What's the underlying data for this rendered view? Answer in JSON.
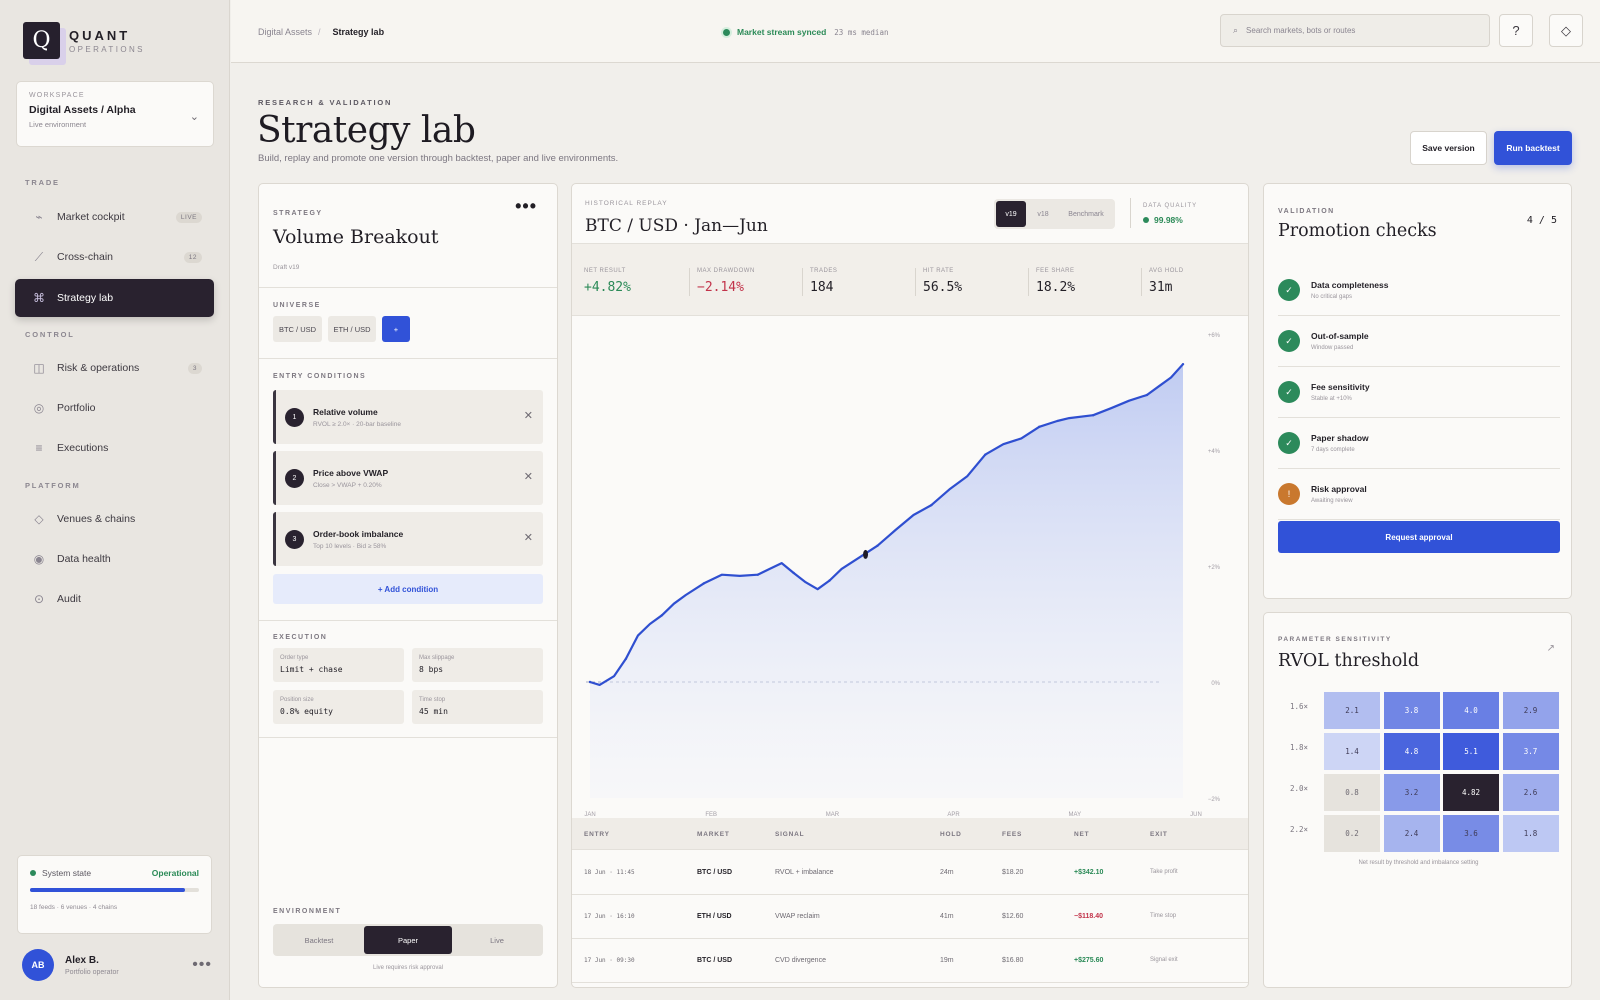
{
  "brand": {
    "logo_letter": "Q",
    "name": "QUANT",
    "tagline": "OPERATIONS"
  },
  "workspace": {
    "label": "WORKSPACE",
    "name": "Digital Assets / Alpha",
    "env": "Live environment"
  },
  "sidebar": {
    "trade_label": "TRADE",
    "control_label": "CONTROL",
    "platform_label": "PLATFORM",
    "items": [
      {
        "label": "Market cockpit",
        "badge": "LIVE",
        "icon": "pulse-icon"
      },
      {
        "label": "Cross-chain",
        "badge": "12",
        "icon": "route-icon"
      },
      {
        "label": "Strategy lab",
        "badge": "",
        "icon": "command-icon",
        "active": true
      },
      {
        "label": "Risk & operations",
        "badge": "3",
        "icon": "grid-icon"
      },
      {
        "label": "Portfolio",
        "badge": "",
        "icon": "circle-icon"
      },
      {
        "label": "Executions",
        "badge": "",
        "icon": "list-icon"
      },
      {
        "label": "Venues & chains",
        "badge": "",
        "icon": "diamond-icon"
      },
      {
        "label": "Data health",
        "badge": "",
        "icon": "target-icon"
      },
      {
        "label": "Audit",
        "badge": "",
        "icon": "dot-circle-icon"
      }
    ]
  },
  "system": {
    "label": "System state",
    "status": "Operational",
    "health": 0.92,
    "meta": "18 feeds · 6 venues · 4 chains"
  },
  "user": {
    "initials": "AB",
    "name": "Alex B.",
    "role": "Portfolio operator"
  },
  "topbar": {
    "crumb_root": "Digital Assets",
    "crumb_sep": "/",
    "crumb_current": "Strategy lab",
    "stream_status": "Market stream synced",
    "latency": "23 ms median",
    "search_placeholder": "Search markets, bots or routes",
    "help": "?",
    "theme": "◇"
  },
  "header": {
    "eyebrow": "RESEARCH & VALIDATION",
    "title": "Strategy lab",
    "subtitle": "Build, replay and promote one version through backtest, paper and live environments.",
    "save_label": "Save version",
    "run_label": "Run backtest"
  },
  "strategy": {
    "label": "STRATEGY",
    "name": "Volume Breakout",
    "draft": "Draft v19",
    "more": "•••",
    "universe_label": "UNIVERSE",
    "universe": [
      "BTC / USD",
      "ETH / USD"
    ],
    "add_universe": "+",
    "entry_label": "ENTRY CONDITIONS",
    "conditions": [
      {
        "n": "1",
        "title": "Relative volume",
        "sub": "RVOL ≥ 2.0× · 20-bar baseline"
      },
      {
        "n": "2",
        "title": "Price above VWAP",
        "sub": "Close > VWAP + 0.20%"
      },
      {
        "n": "3",
        "title": "Order-book imbalance",
        "sub": "Top 10 levels · Bid ≥ 58%"
      }
    ],
    "add_condition": "+ Add condition",
    "execution_label": "EXECUTION",
    "execution": [
      {
        "k": "Order type",
        "v": "Limit + chase"
      },
      {
        "k": "Max slippage",
        "v": "8 bps"
      },
      {
        "k": "Position size",
        "v": "0.8% equity"
      },
      {
        "k": "Time stop",
        "v": "45 min"
      }
    ],
    "env_label": "ENVIRONMENT",
    "env_options": [
      "Backtest",
      "Paper",
      "Live"
    ],
    "env_note": "Live requires risk approval"
  },
  "replay": {
    "label": "HISTORICAL REPLAY",
    "title": "BTC / USD · Jan—Jun",
    "versions": [
      "v19",
      "v18",
      "Benchmark"
    ],
    "dq_label": "DATA QUALITY",
    "dq_value": "99.98%",
    "kpis": [
      {
        "k": "NET RESULT",
        "v": "+4.82%",
        "tone": "pos"
      },
      {
        "k": "MAX DRAWDOWN",
        "v": "−2.14%",
        "tone": "neg"
      },
      {
        "k": "TRADES",
        "v": "184",
        "tone": ""
      },
      {
        "k": "HIT RATE",
        "v": "56.5%",
        "tone": ""
      },
      {
        "k": "FEE SHARE",
        "v": "18.2%",
        "tone": ""
      },
      {
        "k": "AVG HOLD",
        "v": "31m",
        "tone": ""
      }
    ],
    "trade_headers": [
      "ENTRY",
      "MARKET",
      "SIGNAL",
      "HOLD",
      "FEES",
      "NET",
      "EXIT"
    ],
    "trades": [
      [
        "18 Jun · 11:45",
        "BTC / USD",
        "RVOL + imbalance",
        "24m",
        "$18.20",
        "+$342.10",
        "Take profit"
      ],
      [
        "17 Jun · 16:10",
        "ETH / USD",
        "VWAP reclaim",
        "41m",
        "$12.60",
        "−$118.40",
        "Time stop"
      ],
      [
        "17 Jun · 09:30",
        "BTC / USD",
        "CVD divergence",
        "19m",
        "$16.80",
        "+$275.60",
        "Signal exit"
      ]
    ]
  },
  "chart_data": {
    "type": "area",
    "x_ticks": [
      "JAN",
      "FEB",
      "MAR",
      "APR",
      "MAY",
      "JUN"
    ],
    "y_ticks": [
      "+6%",
      "+4%",
      "+2%",
      "0%",
      "−2%"
    ],
    "ylim": [
      -2,
      6
    ],
    "xlim": [
      0,
      5
    ],
    "series": [
      {
        "values": [
          [
            0.0,
            0.0
          ],
          [
            0.08,
            -0.05
          ],
          [
            0.2,
            0.1
          ],
          [
            0.3,
            0.4
          ],
          [
            0.4,
            0.8
          ],
          [
            0.5,
            1.0
          ],
          [
            0.6,
            1.15
          ],
          [
            0.7,
            1.35
          ],
          [
            0.8,
            1.5
          ],
          [
            0.95,
            1.7
          ],
          [
            1.1,
            1.85
          ],
          [
            1.25,
            1.83
          ],
          [
            1.4,
            1.85
          ],
          [
            1.5,
            1.95
          ],
          [
            1.6,
            2.05
          ],
          [
            1.7,
            1.88
          ],
          [
            1.8,
            1.72
          ],
          [
            1.9,
            1.6
          ],
          [
            2.0,
            1.75
          ],
          [
            2.1,
            1.95
          ],
          [
            2.25,
            2.15
          ],
          [
            2.4,
            2.35
          ],
          [
            2.55,
            2.62
          ],
          [
            2.7,
            2.88
          ],
          [
            2.85,
            3.05
          ],
          [
            3.0,
            3.32
          ],
          [
            3.15,
            3.55
          ],
          [
            3.3,
            3.92
          ],
          [
            3.45,
            4.1
          ],
          [
            3.6,
            4.2
          ],
          [
            3.75,
            4.4
          ],
          [
            3.9,
            4.5
          ],
          [
            4.0,
            4.55
          ],
          [
            4.2,
            4.6
          ],
          [
            4.35,
            4.72
          ],
          [
            4.5,
            4.85
          ],
          [
            4.65,
            4.95
          ],
          [
            4.75,
            5.1
          ],
          [
            4.85,
            5.25
          ],
          [
            4.95,
            5.48
          ]
        ]
      }
    ]
  },
  "validation": {
    "label": "VALIDATION",
    "title": "Promotion checks",
    "score": "4 / 5",
    "checks": [
      {
        "title": "Data completeness",
        "sub": "No critical gaps",
        "state": "ok",
        "icon": "✓"
      },
      {
        "title": "Out-of-sample",
        "sub": "Window passed",
        "state": "ok",
        "icon": "✓"
      },
      {
        "title": "Fee sensitivity",
        "sub": "Stable at +10%",
        "state": "ok",
        "icon": "✓"
      },
      {
        "title": "Paper shadow",
        "sub": "7 days complete",
        "state": "ok",
        "icon": "✓"
      },
      {
        "title": "Risk approval",
        "sub": "Awaiting review",
        "state": "pending",
        "icon": "!"
      }
    ],
    "request_label": "Request approval",
    "colors": {
      "ok": "#2c8a5b",
      "pending": "#c9782e"
    }
  },
  "sensitivity": {
    "label": "PARAMETER SENSITIVITY",
    "title": "RVOL threshold",
    "note": "Net result by threshold and imbalance setting",
    "rows": [
      "1.6×",
      "1.8×",
      "2.0×",
      "2.2×"
    ],
    "cells": [
      [
        "2.1",
        "3.8",
        "4.0",
        "2.9"
      ],
      [
        "1.4",
        "4.8",
        "5.1",
        "3.7"
      ],
      [
        "0.8",
        "3.2",
        "4.82",
        "2.6"
      ],
      [
        "0.2",
        "2.4",
        "3.6",
        "1.8"
      ]
    ]
  }
}
